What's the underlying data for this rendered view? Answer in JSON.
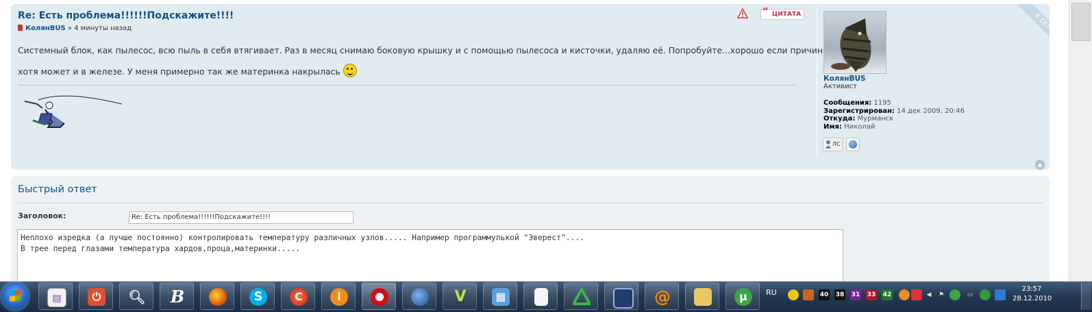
{
  "post": {
    "title": "Re: Есть проблема!!!!!!Подскажите!!!!",
    "author": "КолянBUS",
    "time_sep": " » ",
    "time": "4 минуты назад",
    "body_line1": "Системный блок, как пылесос, всю пыль в себя втягивает. Раз в месяц снимаю боковую крышку и с помощью пылесоса и кисточки, удаляю её. Попробуйте...хорошо если причина в этом,",
    "body_line2": "хотя может и в железе. У меня примерно так же материнка накрылась",
    "quote_label": "ЦИТАТА",
    "online_badge": "В СЕТИ",
    "profile": {
      "name": "КолянBUS",
      "rank": "Активист",
      "messages_label": "Сообщения:",
      "messages": "1195",
      "registered_label": "Зарегистрирован:",
      "registered": "14 дек 2009, 20:46",
      "from_label": "Откуда:",
      "from": "Мурманск",
      "name_label": "Имя:",
      "real_name": "Николай",
      "pm_label": "ЛС"
    }
  },
  "quick_reply": {
    "title": "Быстрый ответ",
    "subject_label": "Заголовок:",
    "subject_value": "Re: Есть проблема!!!!!!Подскажите!!!!",
    "message_line1": "Неплохо изредка (а лучше постоянно) контролировать температуру различных узлов.....  Например программулькой \"Эверест\"....",
    "message_line2": "В трее перед глазами температура хардов,проца,материнки....."
  },
  "taskbar": {
    "language": "RU",
    "clock_time": "23:57",
    "clock_date": "28.12.2010",
    "temps": [
      "40",
      "38",
      "31",
      "33",
      "42"
    ]
  },
  "colors": {
    "post_bg": "#e1ebf2",
    "link": "#105289",
    "quote": "#bc2a4d",
    "quickreply_bg": "#ecf1f3"
  }
}
